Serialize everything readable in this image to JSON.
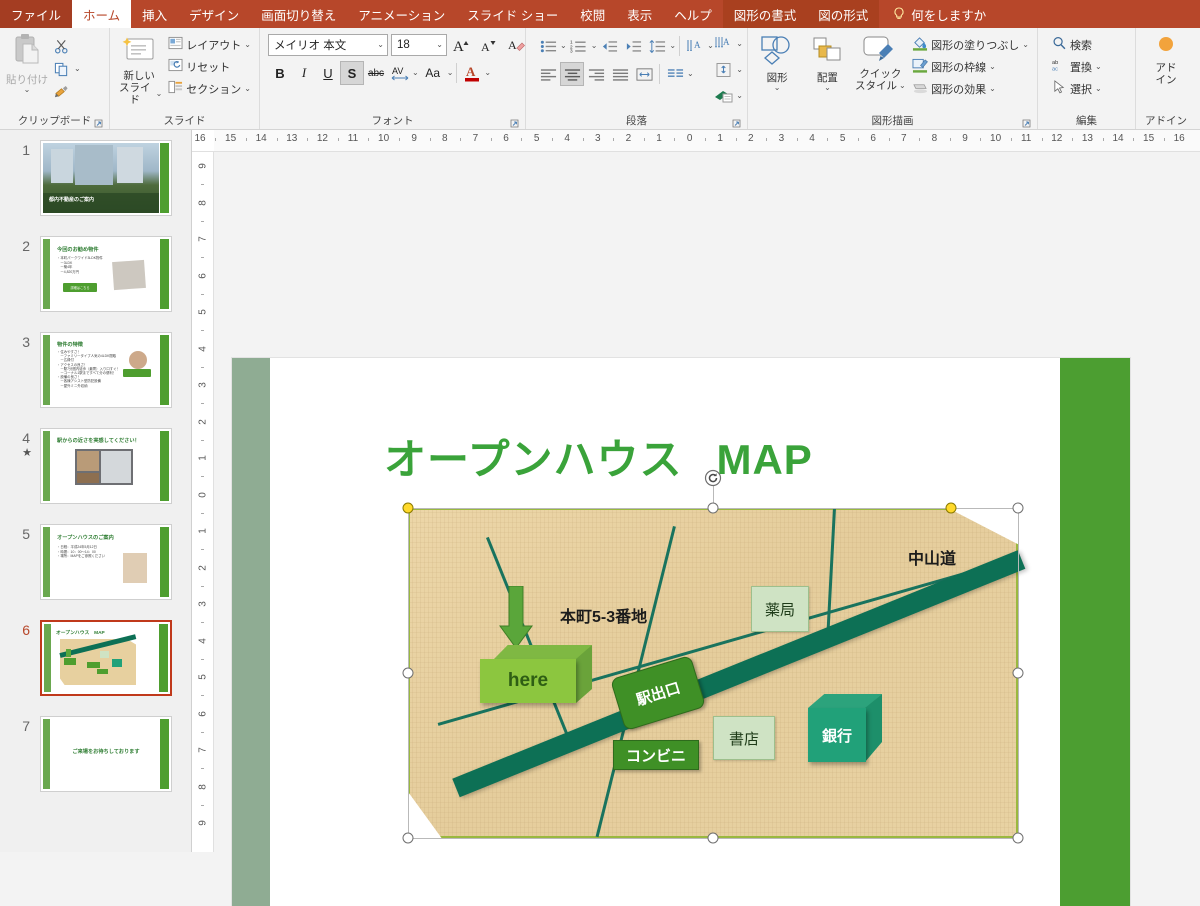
{
  "tabs": [
    {
      "label": "ファイル",
      "kind": "file"
    },
    {
      "label": "ホーム",
      "kind": "active"
    },
    {
      "label": "挿入",
      "kind": "normal"
    },
    {
      "label": "デザイン",
      "kind": "normal"
    },
    {
      "label": "画面切り替え",
      "kind": "normal"
    },
    {
      "label": "アニメーション",
      "kind": "normal"
    },
    {
      "label": "スライド ショー",
      "kind": "normal"
    },
    {
      "label": "校閲",
      "kind": "normal"
    },
    {
      "label": "表示",
      "kind": "normal"
    },
    {
      "label": "ヘルプ",
      "kind": "normal"
    },
    {
      "label": "図形の書式",
      "kind": "contextual"
    },
    {
      "label": "図の形式",
      "kind": "contextual"
    }
  ],
  "tell_me": "何をしますか",
  "ribbon": {
    "clipboard": {
      "group_label": "クリップボード",
      "paste_label": "貼り付け",
      "cut_icon": "scissors-icon",
      "copy_icon": "copy-icon",
      "format_painter_icon": "format-painter-icon"
    },
    "slide": {
      "group_label": "スライド",
      "new_slide_label": "新しい\nスライド",
      "new_slide_line1": "新しい",
      "new_slide_line2": "スライド",
      "layout_label": "レイアウト",
      "reset_label": "リセット",
      "section_label": "セクション"
    },
    "font": {
      "group_label": "フォント",
      "font_name": "メイリオ 本文",
      "font_size": "18",
      "grow_icon": "increase-font-size-icon",
      "shrink_icon": "decrease-font-size-icon",
      "clear_fmt_icon": "clear-formatting-icon",
      "bold": "B",
      "italic": "I",
      "underline": "U",
      "shadow": "S",
      "strike": "abc",
      "spacing": "AV",
      "case": "Aa",
      "color": "A"
    },
    "paragraph": {
      "group_label": "段落",
      "bullets_icon": "bulleted-list-icon",
      "numbering_icon": "numbered-list-icon",
      "decrease_indent_icon": "decrease-indent-icon",
      "increase_indent_icon": "increase-indent-icon",
      "line_spacing_icon": "line-spacing-icon",
      "text_direction_icon": "text-direction-icon",
      "align_text_icon": "align-text-vertical-icon",
      "smartart_icon": "convert-to-smartart-icon",
      "align_left_icon": "align-left-icon",
      "align_center_icon": "align-center-icon",
      "align_right_icon": "align-right-icon",
      "justify_icon": "justify-icon",
      "distribute_icon": "distribute-text-icon",
      "columns_icon": "columns-icon"
    },
    "drawing": {
      "group_label": "図形描画",
      "shapes_label": "図形",
      "arrange_label": "配置",
      "quick_styles_line1": "クイック",
      "quick_styles_line2": "スタイル",
      "shape_fill_label": "図形の塗りつぶし",
      "shape_outline_label": "図形の枠線",
      "shape_effects_label": "図形の効果"
    },
    "editing": {
      "group_label": "編集",
      "find_label": "検索",
      "replace_label": "置換",
      "select_label": "選択"
    },
    "addin": {
      "group_label": "アドイン",
      "line1": "アド",
      "line2": "イン"
    }
  },
  "rulers": {
    "horizontal": [
      "16",
      "15",
      "14",
      "13",
      "12",
      "11",
      "10",
      "9",
      "8",
      "7",
      "6",
      "5",
      "4",
      "3",
      "2",
      "1",
      "0",
      "1",
      "2",
      "3",
      "4",
      "5",
      "6",
      "7",
      "8",
      "9",
      "10",
      "11",
      "12",
      "13",
      "14",
      "15",
      "16"
    ],
    "vertical": [
      "9",
      "8",
      "7",
      "6",
      "5",
      "4",
      "3",
      "2",
      "1",
      "0",
      "1",
      "2",
      "3",
      "4",
      "5",
      "6",
      "7",
      "8",
      "9"
    ]
  },
  "thumbnails": [
    {
      "number": "1",
      "selected": false,
      "starred": false,
      "title": "都内不動産のご案内",
      "kind": "photo-title"
    },
    {
      "number": "2",
      "selected": false,
      "starred": false,
      "title": "今回のお勧め物件",
      "body": [
        "・本町パークワイド3LDK物件",
        "　ー3LDK",
        "　ー築4年",
        "　ー4,820万円"
      ],
      "button": "詳細はこちら"
    },
    {
      "number": "3",
      "selected": false,
      "starred": false,
      "title": "物件の特徴",
      "body": [
        "・住みやすさ！",
        "　ーファミリータイプ人気の4LDK間取",
        "　ー広縁付",
        "・アクセスの良さ！",
        "　ー駅7分圏内徒歩（最寄）入り口すぐ！",
        "　ーコーナル1駅まですべて分の便利！",
        "・設備の良さ！",
        "　ー各棟アシスト型防犯設備",
        "　ー屋外ミニ外収納"
      ]
    },
    {
      "number": "4",
      "selected": false,
      "starred": true,
      "title": "駅からの近さを実感してください！"
    },
    {
      "number": "5",
      "selected": false,
      "starred": false,
      "title": "オープンハウスのご案内",
      "body": [
        "・日程：平成24年5月12日",
        "・時間：10：00〜14：00",
        "・場所：MAPをご参照ください"
      ]
    },
    {
      "number": "6",
      "selected": true,
      "starred": false,
      "title": "オープンハウス　MAP"
    },
    {
      "number": "7",
      "selected": false,
      "starred": false,
      "title": "ご来場をお待ちしております"
    }
  ],
  "slide": {
    "title_part1": "オープンハウス",
    "title_part2": "MAP",
    "map": {
      "here_label": "here",
      "address_label": "本町5-3番地",
      "station_exit_label": "駅出口",
      "pharmacy_label": "薬局",
      "bookstore_label": "書店",
      "convenience_label": "コンビニ",
      "bank_label": "銀行",
      "main_road_label": "中山道"
    },
    "colors": {
      "title_green": "#3aa33a",
      "map_bg": "#e8d2a3",
      "map_border": "#9ab83f",
      "road_teal": "#0d7055",
      "label_green": "#3f9026",
      "label_pale": "#cfe3c4",
      "bank_green": "#21a179",
      "here_green": "#8cc63f",
      "bar_left": "#8fac93",
      "bar_right": "#4c9e31",
      "ribbon_red": "#b7472a"
    }
  }
}
